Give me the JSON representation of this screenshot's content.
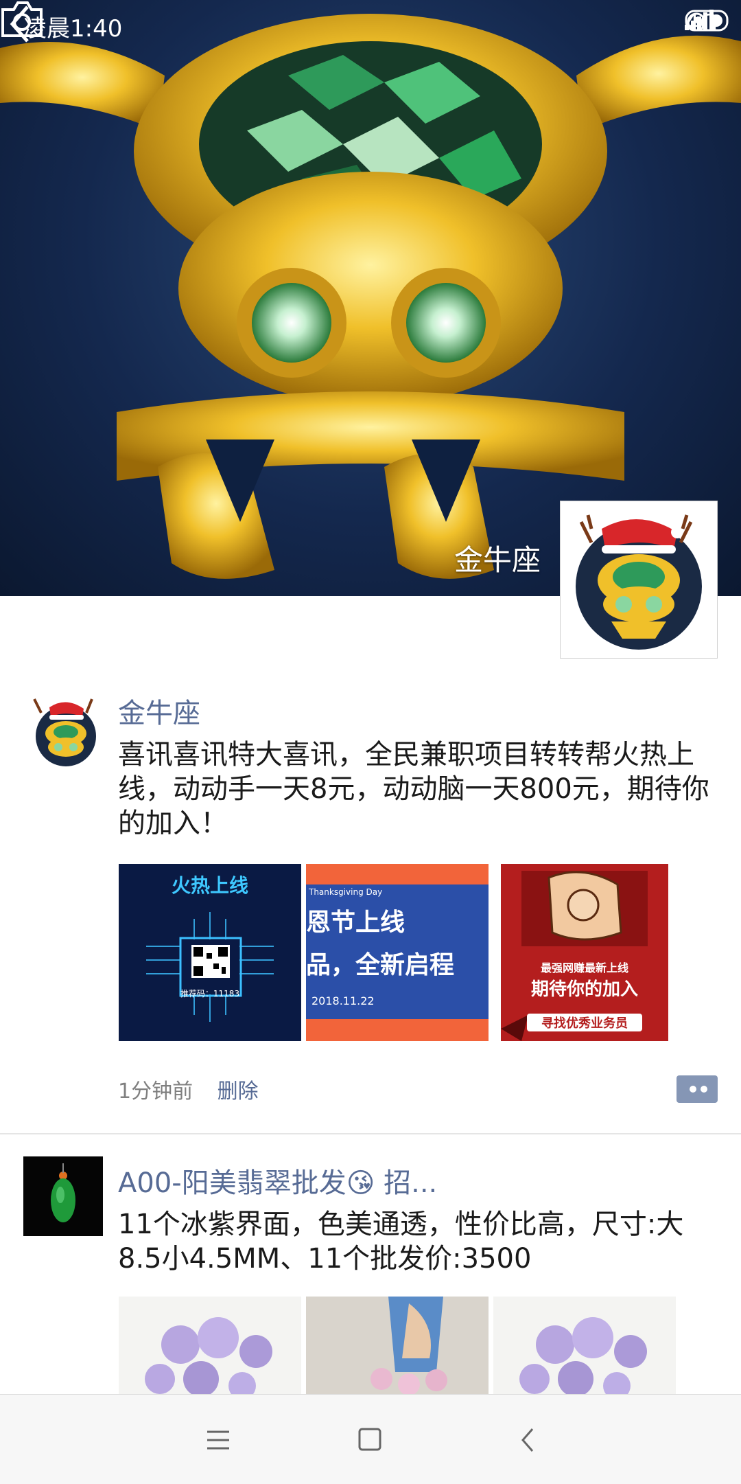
{
  "status": {
    "time": "凌晨1:40",
    "network": "4G"
  },
  "cover": {
    "name": "金牛座"
  },
  "posts": [
    {
      "name": "金牛座",
      "text": "喜讯喜讯特大喜讯，全民兼职项目转转帮火热上线，动动手一天8元，动动脑一天800元，期待你的加入！",
      "photos": [
        {
          "title": "火热上线",
          "code": "推荐码：11183"
        },
        {
          "title": "恩节上线",
          "subtitle": "品，全新启程",
          "tag": "Thanksgiving Day",
          "date": "2018.11.22"
        },
        {
          "title": "最强网赚最新上线",
          "subtitle": "期待你的加入",
          "footer": "寻找优秀业务员"
        }
      ],
      "time": "1分钟前",
      "delete_label": "删除"
    },
    {
      "name": "A00-阳美翡翠批发😘 招...",
      "text": "11个冰紫界面，色美通透，性价比高，尺寸:大8.5小4.5MM、11个批发价:3500"
    }
  ],
  "colors": {
    "link": "#576b95",
    "text": "#1a1a1a",
    "meta": "#7f7f7f"
  }
}
